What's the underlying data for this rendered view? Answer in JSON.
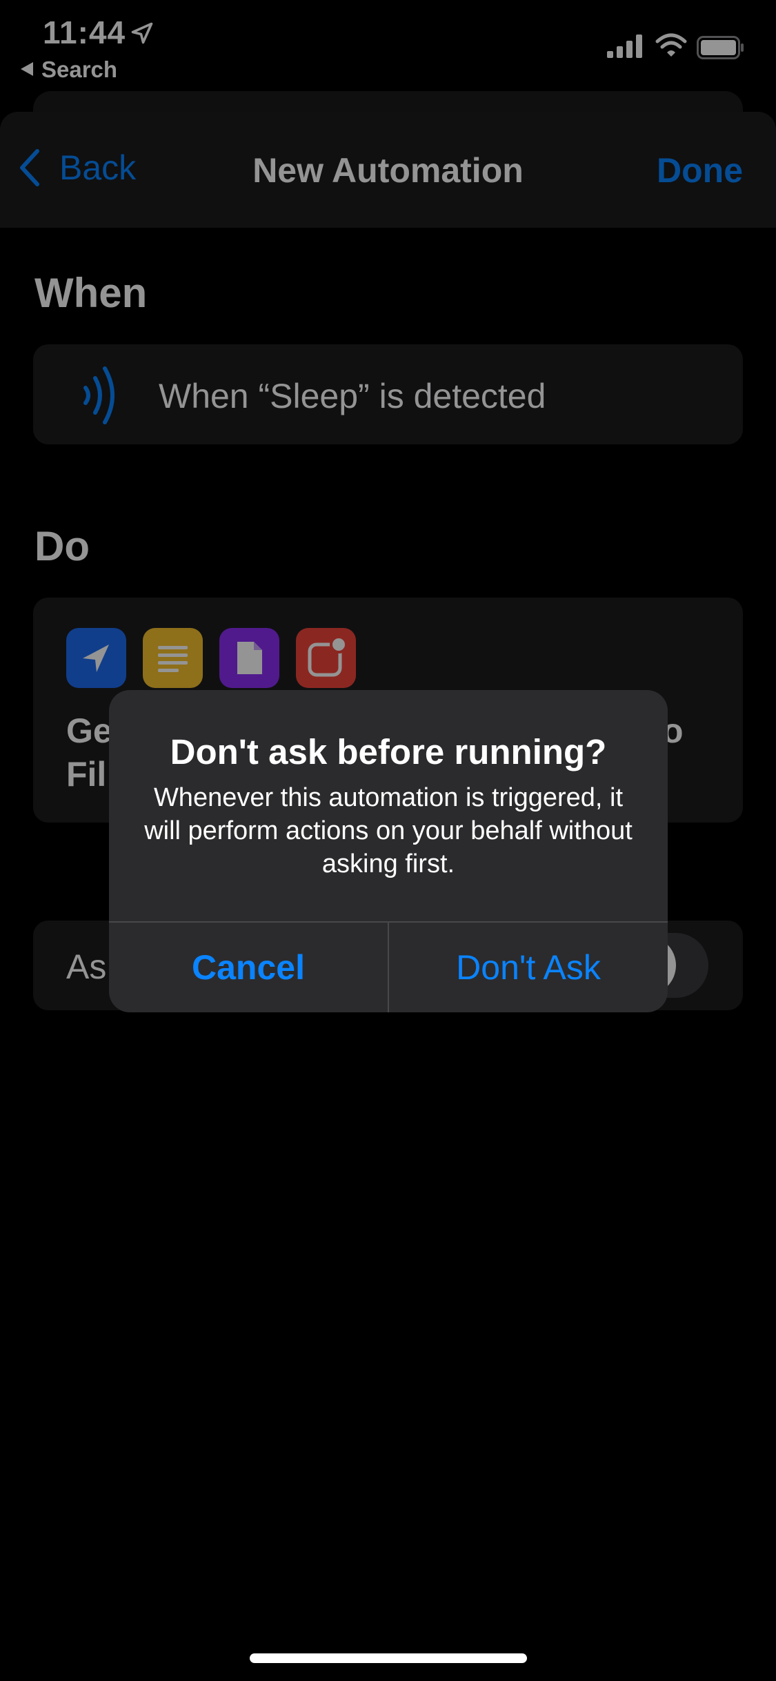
{
  "status_bar": {
    "time": "11:44",
    "back_app": "Search",
    "icons": [
      "location-arrow-icon",
      "cellular-signal-icon",
      "wifi-icon",
      "battery-icon"
    ]
  },
  "nav": {
    "back_label": "Back",
    "title": "New Automation",
    "done_label": "Done"
  },
  "when_section": {
    "heading": "When",
    "trigger_text": "When “Sleep” is detected",
    "icon": "nfc-icon"
  },
  "do_section": {
    "heading": "Do",
    "action_icons": [
      "location-arrow-icon",
      "text-icon",
      "document-icon",
      "notification-icon"
    ],
    "summary_line1_visible": "Ge",
    "summary_line1_end": "o",
    "summary_line2_visible": "Fil"
  },
  "ask_row": {
    "label_visible": "As"
  },
  "alert": {
    "title": "Don't ask before running?",
    "message": "Whenever this automation is triggered, it will perform actions on your behalf without asking first.",
    "cancel_label": "Cancel",
    "confirm_label": "Don't Ask"
  },
  "colors": {
    "accent": "#0a84ff",
    "background": "#000000",
    "card": "#1c1c1e",
    "alert_bg": "#2b2b2d"
  }
}
